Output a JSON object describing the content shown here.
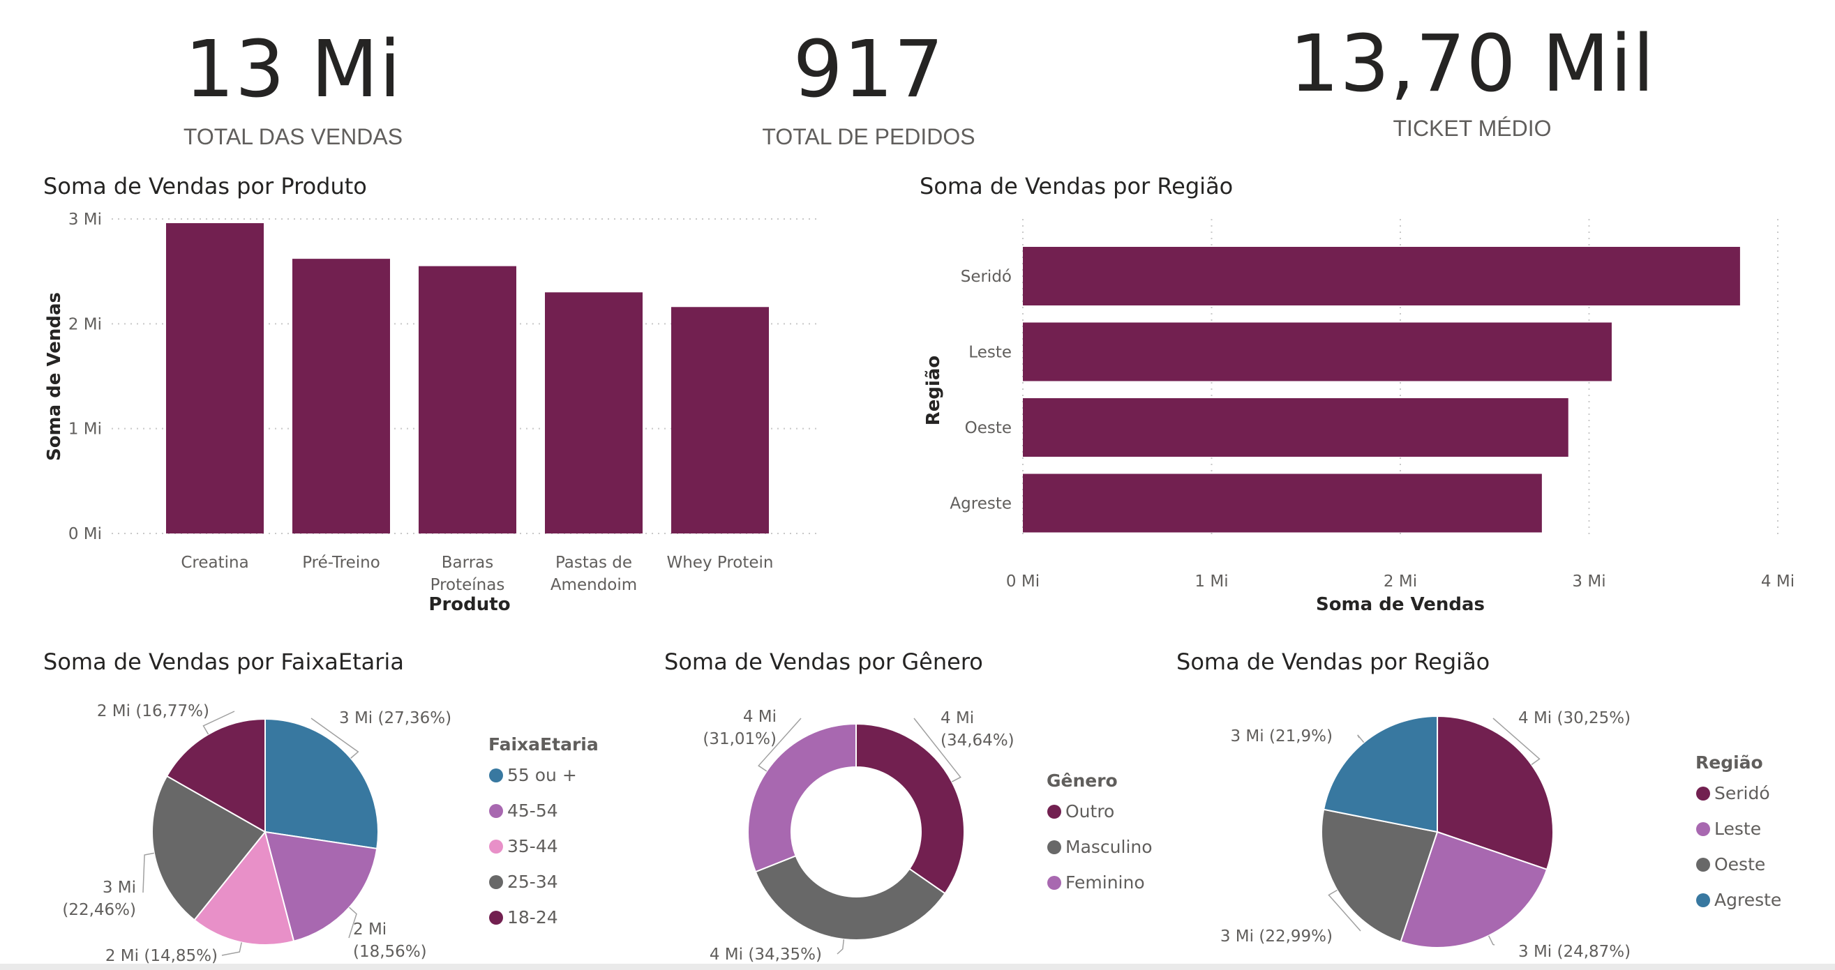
{
  "kpis": {
    "total_vendas": {
      "value": "13 Mi",
      "label": "TOTAL DAS VENDAS"
    },
    "total_pedidos": {
      "value": "917",
      "label": "TOTAL DE PEDIDOS"
    },
    "ticket_medio": {
      "value": "13,70 Mil",
      "label": "TICKET MÉDIO"
    }
  },
  "colors": {
    "plum": "#722050",
    "blue": "#3878a0",
    "lilac": "#a868b0",
    "pink": "#e890c8",
    "gray": "#686868",
    "grid": "#c8c8c8"
  },
  "chart_data": [
    {
      "id": "produto",
      "type": "bar",
      "title": "Soma de Vendas por Produto",
      "xlabel": "Produto",
      "ylabel": "Soma de Vendas",
      "categories": [
        [
          "Creatina"
        ],
        [
          "Pré-Treino"
        ],
        [
          "Barras",
          "Proteínas"
        ],
        [
          "Pastas de",
          "Amendoim"
        ],
        [
          "Whey Protein"
        ]
      ],
      "values": [
        2.96,
        2.62,
        2.55,
        2.3,
        2.16
      ],
      "unit": "Mi",
      "ylim": [
        0,
        3
      ],
      "yticks": [
        "0 Mi",
        "1 Mi",
        "2 Mi",
        "3 Mi"
      ],
      "color": "#722050",
      "grid": true
    },
    {
      "id": "regiao_bar",
      "type": "bar",
      "orientation": "horizontal",
      "title": "Soma de Vendas por Região",
      "xlabel": "Soma de Vendas",
      "ylabel": "Região",
      "categories": [
        "Seridó",
        "Leste",
        "Oeste",
        "Agreste"
      ],
      "values": [
        3.8,
        3.12,
        2.89,
        2.75
      ],
      "unit": "Mi",
      "xlim": [
        0,
        4
      ],
      "xticks": [
        "0 Mi",
        "1 Mi",
        "2 Mi",
        "3 Mi",
        "4 Mi"
      ],
      "color": "#722050",
      "grid": true
    },
    {
      "id": "faixa",
      "type": "pie",
      "title": "Soma de Vendas por FaixaEtaria",
      "legend_title": "FaixaEtaria",
      "legend_position": "right",
      "slices": [
        {
          "name": "55 ou +",
          "percent": 27.36,
          "label": [
            "3 Mi (27,36%)"
          ],
          "color": "#3878a0"
        },
        {
          "name": "45-54",
          "percent": 18.56,
          "label": [
            "2 Mi",
            "(18,56%)"
          ],
          "color": "#a868b0"
        },
        {
          "name": "35-44",
          "percent": 14.85,
          "label": [
            "2 Mi (14,85%)"
          ],
          "color": "#e890c8"
        },
        {
          "name": "25-34",
          "percent": 22.46,
          "label": [
            "3 Mi",
            "(22,46%)"
          ],
          "color": "#686868"
        },
        {
          "name": "18-24",
          "percent": 16.77,
          "label": [
            "2 Mi (16,77%)"
          ],
          "color": "#722050"
        }
      ]
    },
    {
      "id": "genero",
      "type": "pie",
      "donut": true,
      "title": "Soma de Vendas por Gênero",
      "legend_title": "Gênero",
      "legend_position": "right",
      "slices": [
        {
          "name": "Outro",
          "percent": 34.64,
          "label": [
            "4 Mi",
            "(34,64%)"
          ],
          "color": "#722050"
        },
        {
          "name": "Masculino",
          "percent": 34.35,
          "label": [
            "4 Mi (34,35%)"
          ],
          "color": "#686868"
        },
        {
          "name": "Feminino",
          "percent": 31.01,
          "label": [
            "4 Mi",
            "(31,01%)"
          ],
          "color": "#a868b0"
        }
      ]
    },
    {
      "id": "regiao_pie",
      "type": "pie",
      "title": "Soma de Vendas por Região",
      "legend_title": "Região",
      "legend_position": "right",
      "slices": [
        {
          "name": "Seridó",
          "percent": 30.25,
          "label": [
            "4 Mi (30,25%)"
          ],
          "color": "#722050"
        },
        {
          "name": "Leste",
          "percent": 24.87,
          "label": [
            "3 Mi (24,87%)"
          ],
          "color": "#a868b0"
        },
        {
          "name": "Oeste",
          "percent": 22.99,
          "label": [
            "3 Mi (22,99%)"
          ],
          "color": "#686868"
        },
        {
          "name": "Agreste",
          "percent": 21.9,
          "label": [
            "3 Mi (21,9%)"
          ],
          "color": "#3878a0"
        }
      ]
    }
  ]
}
